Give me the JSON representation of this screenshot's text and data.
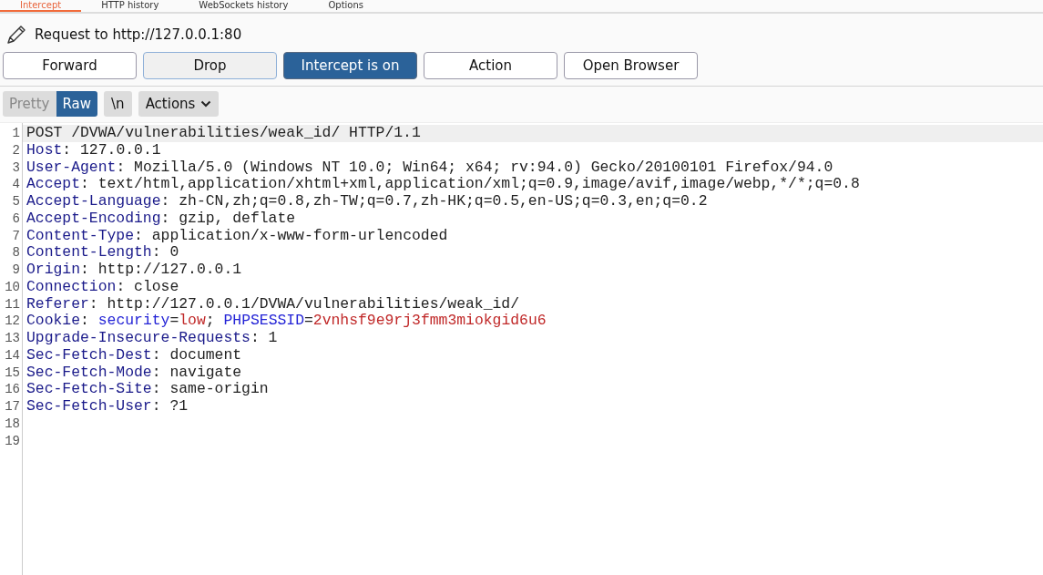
{
  "tabs": [
    {
      "label": "Intercept",
      "selected": true
    },
    {
      "label": "HTTP history",
      "selected": false
    },
    {
      "label": "WebSockets history",
      "selected": false
    },
    {
      "label": "Options",
      "selected": false
    }
  ],
  "request_title": "Request to http://127.0.0.1:80",
  "buttons": [
    {
      "label": "Forward",
      "kind": "plain"
    },
    {
      "label": "Drop",
      "kind": "focused"
    },
    {
      "label": "Intercept is on",
      "kind": "toggle",
      "on": true
    },
    {
      "label": "Action",
      "kind": "plain"
    },
    {
      "label": "Open Browser",
      "kind": "plain"
    }
  ],
  "view_tabs": [
    {
      "label": "Pretty",
      "selected": false
    },
    {
      "label": "Raw",
      "selected": true
    }
  ],
  "newline_button": "\\n",
  "actions_menu": "Actions",
  "editor": {
    "lines": [
      {
        "number": "1",
        "highlighted": true,
        "segments": [
          {
            "kind": "plain",
            "text": "POST /DVWA/vulnerabilities/weak_id/ HTTP/1.1"
          }
        ]
      },
      {
        "number": "2",
        "highlighted": false,
        "segments": [
          {
            "kind": "header",
            "text": "Host"
          },
          {
            "kind": "plain",
            "text": ": 127.0.0.1"
          }
        ]
      },
      {
        "number": "3",
        "highlighted": false,
        "segments": [
          {
            "kind": "header",
            "text": "User-Agent"
          },
          {
            "kind": "plain",
            "text": ": Mozilla/5.0 (Windows NT 10.0; Win64; x64; rv:94.0) Gecko/20100101 Firefox/94.0"
          }
        ]
      },
      {
        "number": "4",
        "highlighted": false,
        "segments": [
          {
            "kind": "header",
            "text": "Accept"
          },
          {
            "kind": "plain",
            "text": ": text/html,application/xhtml+xml,application/xml;q=0.9,image/avif,image/webp,*/*;q=0.8"
          }
        ]
      },
      {
        "number": "5",
        "highlighted": false,
        "segments": [
          {
            "kind": "header",
            "text": "Accept-Language"
          },
          {
            "kind": "plain",
            "text": ": zh-CN,zh;q=0.8,zh-TW;q=0.7,zh-HK;q=0.5,en-US;q=0.3,en;q=0.2"
          }
        ]
      },
      {
        "number": "6",
        "highlighted": false,
        "segments": [
          {
            "kind": "header",
            "text": "Accept-Encoding"
          },
          {
            "kind": "plain",
            "text": ": gzip, deflate"
          }
        ]
      },
      {
        "number": "7",
        "highlighted": false,
        "segments": [
          {
            "kind": "header",
            "text": "Content-Type"
          },
          {
            "kind": "plain",
            "text": ": application/x-www-form-urlencoded"
          }
        ]
      },
      {
        "number": "8",
        "highlighted": false,
        "segments": [
          {
            "kind": "header",
            "text": "Content-Length"
          },
          {
            "kind": "plain",
            "text": ": 0"
          }
        ]
      },
      {
        "number": "9",
        "highlighted": false,
        "segments": [
          {
            "kind": "header",
            "text": "Origin"
          },
          {
            "kind": "plain",
            "text": ": http://127.0.0.1"
          }
        ]
      },
      {
        "number": "10",
        "highlighted": false,
        "segments": [
          {
            "kind": "header",
            "text": "Connection"
          },
          {
            "kind": "plain",
            "text": ": close"
          }
        ]
      },
      {
        "number": "11",
        "highlighted": false,
        "segments": [
          {
            "kind": "header",
            "text": "Referer"
          },
          {
            "kind": "plain",
            "text": ": http://127.0.0.1/DVWA/vulnerabilities/weak_id/"
          }
        ]
      },
      {
        "number": "12",
        "highlighted": false,
        "segments": [
          {
            "kind": "header",
            "text": "Cookie"
          },
          {
            "kind": "plain",
            "text": ": "
          },
          {
            "kind": "param_name",
            "text": "security"
          },
          {
            "kind": "plain",
            "text": "="
          },
          {
            "kind": "param_value",
            "text": "low"
          },
          {
            "kind": "plain",
            "text": "; "
          },
          {
            "kind": "param_name",
            "text": "PHPSESSID"
          },
          {
            "kind": "plain",
            "text": "="
          },
          {
            "kind": "param_value",
            "text": "2vnhsf9e9rj3fmm3miokgid6u6"
          }
        ]
      },
      {
        "number": "13",
        "highlighted": false,
        "segments": [
          {
            "kind": "header",
            "text": "Upgrade-Insecure-Requests"
          },
          {
            "kind": "plain",
            "text": ": 1"
          }
        ]
      },
      {
        "number": "14",
        "highlighted": false,
        "segments": [
          {
            "kind": "header",
            "text": "Sec-Fetch-Dest"
          },
          {
            "kind": "plain",
            "text": ": document"
          }
        ]
      },
      {
        "number": "15",
        "highlighted": false,
        "segments": [
          {
            "kind": "header",
            "text": "Sec-Fetch-Mode"
          },
          {
            "kind": "plain",
            "text": ": navigate"
          }
        ]
      },
      {
        "number": "16",
        "highlighted": false,
        "segments": [
          {
            "kind": "header",
            "text": "Sec-Fetch-Site"
          },
          {
            "kind": "plain",
            "text": ": same-origin"
          }
        ]
      },
      {
        "number": "17",
        "highlighted": false,
        "segments": [
          {
            "kind": "header",
            "text": "Sec-Fetch-User"
          },
          {
            "kind": "plain",
            "text": ": ?1"
          }
        ]
      },
      {
        "number": "18",
        "highlighted": false
      },
      {
        "number": "19",
        "highlighted": false
      }
    ]
  }
}
